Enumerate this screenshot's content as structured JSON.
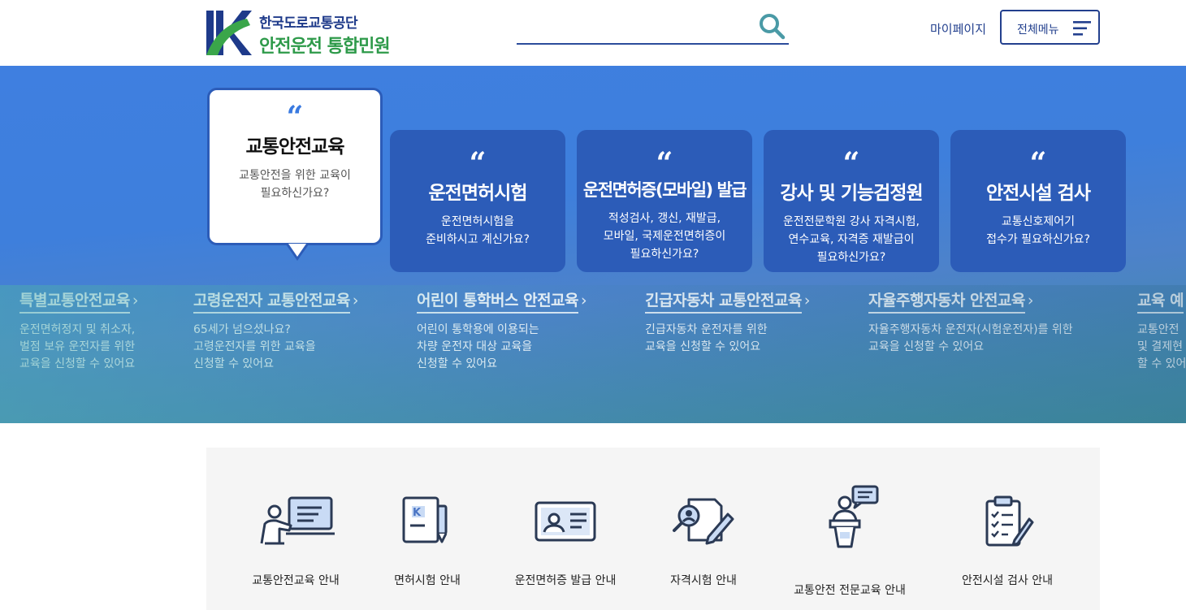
{
  "header": {
    "org_name": "한국도로교통공단",
    "service_name": "안전운전 통합민원",
    "search": {
      "value": "",
      "placeholder": ""
    },
    "mypage_label": "마이페이지",
    "allmenu_label": "전체메뉴"
  },
  "hero": {
    "cards": [
      {
        "quote": "“",
        "title": "교통안전교육",
        "desc1": "교통안전을 위한 교육이",
        "desc2": "필요하신가요?",
        "desc3": "",
        "active": true
      },
      {
        "quote": "“",
        "title": "운전면허시험",
        "desc1": "운전면허시험을",
        "desc2": "준비하시고 계신가요?",
        "desc3": "",
        "active": false
      },
      {
        "quote": "“",
        "title": "운전면허증(모바일) 발급",
        "desc1": "적성검사, 갱신, 재발급,",
        "desc2": "모바일, 국제운전면허증이",
        "desc3": "필요하신가요?",
        "active": false
      },
      {
        "quote": "“",
        "title": "강사 및 기능검정원",
        "desc1": "운전전문학원 강사 자격시험,",
        "desc2": "연수교육, 자격증 재발급이",
        "desc3": "필요하신가요?",
        "active": false
      },
      {
        "quote": "“",
        "title": "안전시설 검사",
        "desc1": "교통신호제어기",
        "desc2": "접수가 필요하신가요?",
        "desc3": "",
        "active": false
      }
    ],
    "sub_items": [
      {
        "title": "특별교통안전교육",
        "arrow": "›",
        "desc1": "운전면허정지 및 취소자,",
        "desc2": "벌점 보유 운전자를 위한",
        "desc3": "교육을 신청할 수 있어요"
      },
      {
        "title": "고령운전자 교통안전교육",
        "arrow": "›",
        "desc1": "65세가 넘으셨나요?",
        "desc2": "고령운전자를 위한 교육을",
        "desc3": "신청할 수 있어요"
      },
      {
        "title": "어린이 통학버스 안전교육",
        "arrow": "›",
        "desc1": "어린이 통학용에 이용되는",
        "desc2": "차량 운전자 대상 교육을",
        "desc3": "신청할 수 있어요"
      },
      {
        "title": "긴급자동차 교통안전교육",
        "arrow": "›",
        "desc1": "긴급자동차 운전자를 위한",
        "desc2": "교육을 신청할 수 있어요",
        "desc3": ""
      },
      {
        "title": "자율주행자동차 안전교육",
        "arrow": "›",
        "desc1": "자율주행자동차 운전자(시험운전자)를 위한",
        "desc2": "교육을 신청할 수 있어요",
        "desc3": ""
      },
      {
        "title": "교육 예",
        "arrow": "",
        "desc1": "교통안전",
        "desc2": "및 결제현",
        "desc3": "할 수 있어"
      }
    ]
  },
  "quick_links": [
    {
      "label": "교통안전교육 안내",
      "icon": "lecture-icon"
    },
    {
      "label": "면허시험 안내",
      "icon": "license-document-icon"
    },
    {
      "label": "운전면허증 발급 안내",
      "icon": "id-card-icon"
    },
    {
      "label": "자격시험 안내",
      "icon": "exam-magnifier-icon"
    },
    {
      "label": "교통안전 전문교육 안내",
      "icon": "podium-speaker-icon"
    },
    {
      "label": "안전시설 검사 안내",
      "icon": "checklist-clipboard-icon"
    }
  ],
  "colors": {
    "primary": "#23408e",
    "accent_green": "#2e9a4a",
    "card_blue": "#2c5cb8",
    "hero_blue": "#3f7fe0"
  }
}
